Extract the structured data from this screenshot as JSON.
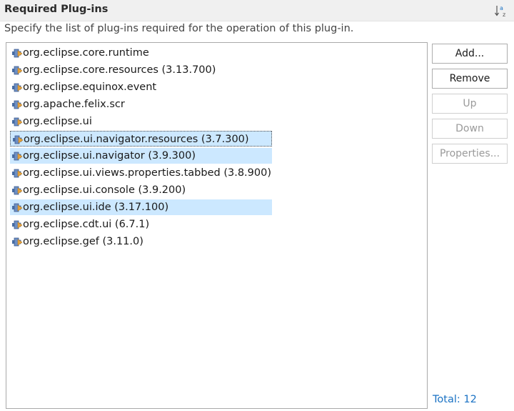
{
  "section": {
    "title": "Required Plug-ins",
    "description": "Specify the list of plug-ins required for the operation of this plug-in.",
    "sort_icon": "sort-alphabetical-icon"
  },
  "plugins": [
    {
      "label": "org.eclipse.core.runtime",
      "selected": false,
      "focused": false
    },
    {
      "label": "org.eclipse.core.resources (3.13.700)",
      "selected": false,
      "focused": false
    },
    {
      "label": "org.eclipse.equinox.event",
      "selected": false,
      "focused": false
    },
    {
      "label": "org.apache.felix.scr",
      "selected": false,
      "focused": false
    },
    {
      "label": "org.eclipse.ui",
      "selected": false,
      "focused": false
    },
    {
      "label": "org.eclipse.ui.navigator.resources (3.7.300)",
      "selected": true,
      "focused": true
    },
    {
      "label": "org.eclipse.ui.navigator (3.9.300)",
      "selected": true,
      "focused": false
    },
    {
      "label": "org.eclipse.ui.views.properties.tabbed (3.8.900)",
      "selected": false,
      "focused": false
    },
    {
      "label": "org.eclipse.ui.console (3.9.200)",
      "selected": false,
      "focused": false
    },
    {
      "label": "org.eclipse.ui.ide (3.17.100)",
      "selected": true,
      "focused": false
    },
    {
      "label": "org.eclipse.cdt.ui (6.7.1)",
      "selected": false,
      "focused": false
    },
    {
      "label": "org.eclipse.gef (3.11.0)",
      "selected": false,
      "focused": false
    }
  ],
  "buttons": {
    "add": "Add...",
    "remove": "Remove",
    "up": "Up",
    "down": "Down",
    "properties": "Properties..."
  },
  "total": "Total: 12",
  "colors": {
    "selection": "#cce8ff",
    "link": "#1a72c4",
    "header_bg": "#f0f0f0"
  }
}
